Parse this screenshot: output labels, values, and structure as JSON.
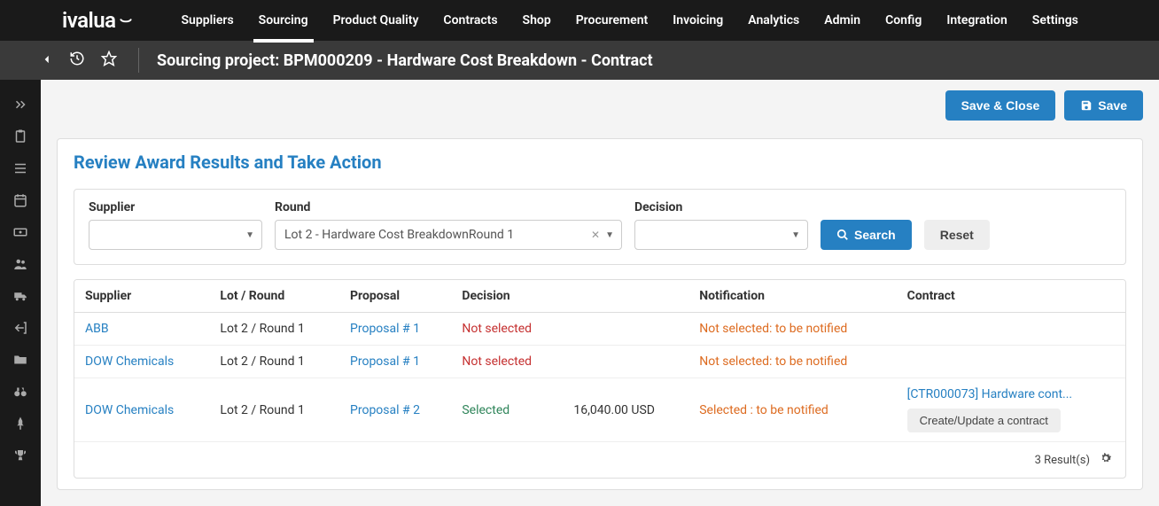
{
  "logo": "ivalua",
  "nav": [
    "Suppliers",
    "Sourcing",
    "Product Quality",
    "Contracts",
    "Shop",
    "Procurement",
    "Invoicing",
    "Analytics",
    "Admin",
    "Config",
    "Integration",
    "Settings"
  ],
  "nav_active_index": 1,
  "page_title": "Sourcing project: BPM000209 - Hardware Cost Breakdown - Contract",
  "actions": {
    "save_close": "Save & Close",
    "save": "Save"
  },
  "panel_title": "Review Award Results and Take Action",
  "filters": {
    "supplier": {
      "label": "Supplier",
      "value": ""
    },
    "round": {
      "label": "Round",
      "value": "Lot 2 - Hardware Cost BreakdownRound 1"
    },
    "decision": {
      "label": "Decision",
      "value": ""
    },
    "search": "Search",
    "reset": "Reset"
  },
  "columns": [
    "Supplier",
    "Lot / Round",
    "Proposal",
    "Decision",
    "",
    "Notification",
    "Contract"
  ],
  "rows": [
    {
      "supplier": "ABB",
      "lot": "Lot 2 / Round 1",
      "proposal": "Proposal # 1",
      "decision": "Not selected",
      "decision_class": "red",
      "amount": "",
      "notification": "Not selected: to be notified",
      "notif_class": "orange",
      "contract_link": "",
      "contract_btn": ""
    },
    {
      "supplier": "DOW Chemicals",
      "lot": "Lot 2 / Round 1",
      "proposal": "Proposal # 1",
      "decision": "Not selected",
      "decision_class": "red",
      "amount": "",
      "notification": "Not selected: to be notified",
      "notif_class": "orange",
      "contract_link": "",
      "contract_btn": ""
    },
    {
      "supplier": "DOW Chemicals",
      "lot": "Lot 2 / Round 1",
      "proposal": "Proposal # 2",
      "decision": "Selected",
      "decision_class": "green",
      "amount": "16,040.00 USD",
      "notification": "Selected : to be notified",
      "notif_class": "orange",
      "contract_link": "[CTR000073] Hardware cont...",
      "contract_btn": "Create/Update a contract"
    }
  ],
  "results_text": "3  Result(s)",
  "sidebar_icons": [
    "expand",
    "clipboard",
    "list",
    "calendar",
    "cash",
    "users",
    "truck",
    "exit",
    "folder",
    "binoculars",
    "pin",
    "trophy"
  ]
}
